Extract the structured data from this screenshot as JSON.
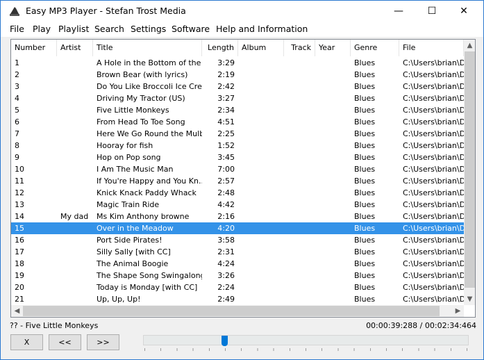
{
  "window": {
    "title": "Easy MP3 Player - Stefan Trost Media",
    "controls": [
      "—",
      "☐",
      "✕"
    ]
  },
  "menu": [
    "File",
    "Play",
    "Playlist",
    "Search",
    "Settings",
    "Software",
    "Help and Information"
  ],
  "columns": [
    "Number",
    "Artist",
    "Title",
    "Length",
    "Album",
    "Track",
    "Year",
    "Genre",
    "File"
  ],
  "rows": [
    [
      "1",
      "",
      "A Hole in the Bottom of the ...",
      "3:29",
      "Blues",
      "C:\\Users\\brian\\De"
    ],
    [
      "2",
      "",
      "Brown Bear (with lyrics)",
      "2:19",
      "Blues",
      "C:\\Users\\brian\\De"
    ],
    [
      "3",
      "",
      "Do You Like Broccoli Ice Cre...",
      "2:42",
      "Blues",
      "C:\\Users\\brian\\De"
    ],
    [
      "4",
      "",
      "Driving My Tractor (US)",
      "3:27",
      "Blues",
      "C:\\Users\\brian\\De"
    ],
    [
      "5",
      "",
      "Five Little Monkeys",
      "2:34",
      "Blues",
      "C:\\Users\\brian\\De"
    ],
    [
      "6",
      "",
      "From Head To Toe Song",
      "4:51",
      "Blues",
      "C:\\Users\\brian\\De"
    ],
    [
      "7",
      "",
      "Here We Go Round the Mulb...",
      "2:25",
      "Blues",
      "C:\\Users\\brian\\De"
    ],
    [
      "8",
      "",
      "Hooray for fish",
      "1:52",
      "Blues",
      "C:\\Users\\brian\\De"
    ],
    [
      "9",
      "",
      "Hop on Pop song",
      "3:45",
      "Blues",
      "C:\\Users\\brian\\De"
    ],
    [
      "10",
      "",
      "I Am The Music Man",
      "7:00",
      "Blues",
      "C:\\Users\\brian\\De"
    ],
    [
      "11",
      "",
      "If You're Happy and You Kn...",
      "2:57",
      "Blues",
      "C:\\Users\\brian\\De"
    ],
    [
      "12",
      "",
      "Knick Knack Paddy Whack",
      "2:48",
      "Blues",
      "C:\\Users\\brian\\De"
    ],
    [
      "13",
      "",
      "Magic Train Ride",
      "4:42",
      "Blues",
      "C:\\Users\\brian\\De"
    ],
    [
      "14",
      "My dad",
      "Ms Kim Anthony browne",
      "2:16",
      "Blues",
      "C:\\Users\\brian\\De"
    ],
    [
      "15",
      "",
      "Over in the Meadow",
      "4:20",
      "Blues",
      "C:\\Users\\brian\\De"
    ],
    [
      "16",
      "",
      "Port Side Pirates!",
      "3:58",
      "Blues",
      "C:\\Users\\brian\\De"
    ],
    [
      "17",
      "",
      "Silly Sally [with CC]",
      "2:31",
      "Blues",
      "C:\\Users\\brian\\De"
    ],
    [
      "18",
      "",
      "The Animal Boogie",
      "4:24",
      "Blues",
      "C:\\Users\\brian\\De"
    ],
    [
      "19",
      "",
      "The Shape Song Swingalong",
      "3:26",
      "Blues",
      "C:\\Users\\brian\\De"
    ],
    [
      "20",
      "",
      "Today is Monday [with CC]",
      "2:24",
      "Blues",
      "C:\\Users\\brian\\De"
    ],
    [
      "21",
      "",
      "Up, Up, Up!",
      "2:49",
      "Blues",
      "C:\\Users\\brian\\De"
    ]
  ],
  "selected_row": 15,
  "status": {
    "now_playing": "?? - Five Little Monkeys",
    "position": "00:00:39:288",
    "separator": "/",
    "duration": "00:02:34:464"
  },
  "buttons": {
    "stop": "X",
    "prev": "<<",
    "next": ">>"
  },
  "seek_fraction": 0.25,
  "colors": {
    "selection": "#3392e8",
    "accent": "#0078d7"
  }
}
